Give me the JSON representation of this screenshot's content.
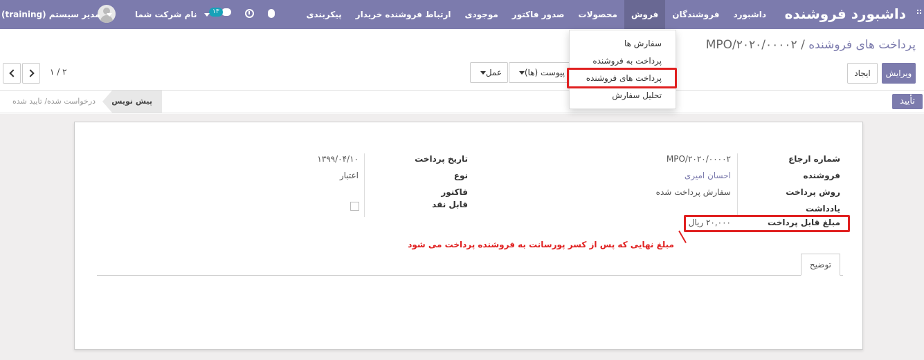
{
  "navbar": {
    "brand": "داشبورد فروشنده",
    "menu": [
      "داشبورد",
      "فروشندگان",
      "فروش",
      "محصولات",
      "صدور فاکتور",
      "موجودی",
      "ارتباط فروشنده خریدار",
      "پیکربندی"
    ],
    "active_menu": "فروش",
    "company": "نام شرکت شما",
    "user": "مدیر سیستم (training)",
    "chat_badge": "۱۳",
    "accent": "#7c7bad"
  },
  "dropdown": {
    "items": [
      "سفارش ها",
      "پرداخت به فروشنده",
      "پرداخت های فروشنده",
      "تحلیل سفارش"
    ],
    "highlighted": "پرداخت های فروشنده"
  },
  "breadcrumb": {
    "parent": "پرداخت های فروشنده",
    "separator": "/",
    "current": "MPO/۲۰۲۰/۰۰۰۰۲"
  },
  "toolbar": {
    "edit": "ویرایش",
    "create": "ایجاد",
    "action": "عمل",
    "attachments": "پیوست (ها)",
    "pager": "۲ / ۱"
  },
  "statusbar": {
    "confirm": "تأیید",
    "stages": [
      "پیش نویس",
      "درخواست شده/ تایید شده"
    ],
    "current_stage": "پیش نویس"
  },
  "form": {
    "reference_label": "شماره ارجاع",
    "reference_value": "MPO/۲۰۲۰/۰۰۰۰۲",
    "vendor_label": "فروشنده",
    "vendor_value": "احسان امیری",
    "method_label": "روش پرداخت",
    "method_value": "سفارش پرداخت شده",
    "note_label": "یادداشت",
    "amount_label": "مبلغ قابل پرداخت",
    "amount_value": "۲۰,۰۰۰ ریال",
    "date_label": "تاریخ پرداخت",
    "date_value": "۱۳۹۹/۰۴/۱۰",
    "type_label": "نوع",
    "type_value": "اعتبار",
    "invoice_label": "فاکتور",
    "cashable_label": "قابل نقد",
    "tab_description": "توضیح"
  },
  "annotation": {
    "text": "مبلغ نهایی که پس از کسر پورسانت به فروشنده پرداخت می شود",
    "color": "#e02020"
  }
}
